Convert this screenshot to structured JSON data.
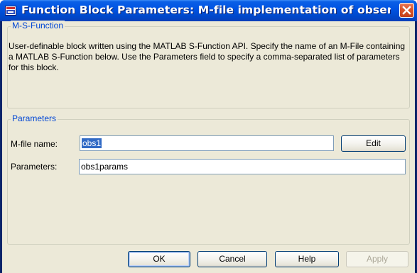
{
  "window": {
    "title": "Function Block Parameters: M-file implementation of observ...",
    "close_glyph": "close-icon"
  },
  "sfunction_group": {
    "legend": "M-S-Function",
    "description": "User-definable block written using the MATLAB S-Function API. Specify the name of an  M-File containing a MATLAB S-Function below. Use the Parameters field to specify a comma-separated list of parameters for this block."
  },
  "parameters_group": {
    "legend": "Parameters",
    "mfile_label": "M-file name:",
    "mfile_value": "obs1",
    "edit_label": "Edit",
    "params_label": "Parameters:",
    "params_value": "obs1params"
  },
  "buttons": {
    "ok": "OK",
    "cancel": "Cancel",
    "help": "Help",
    "apply": "Apply"
  },
  "colors": {
    "title_bar": "#0054e3",
    "legend_text": "#0046d5",
    "selection": "#316ac5",
    "dialog_bg": "#ece9d8"
  }
}
